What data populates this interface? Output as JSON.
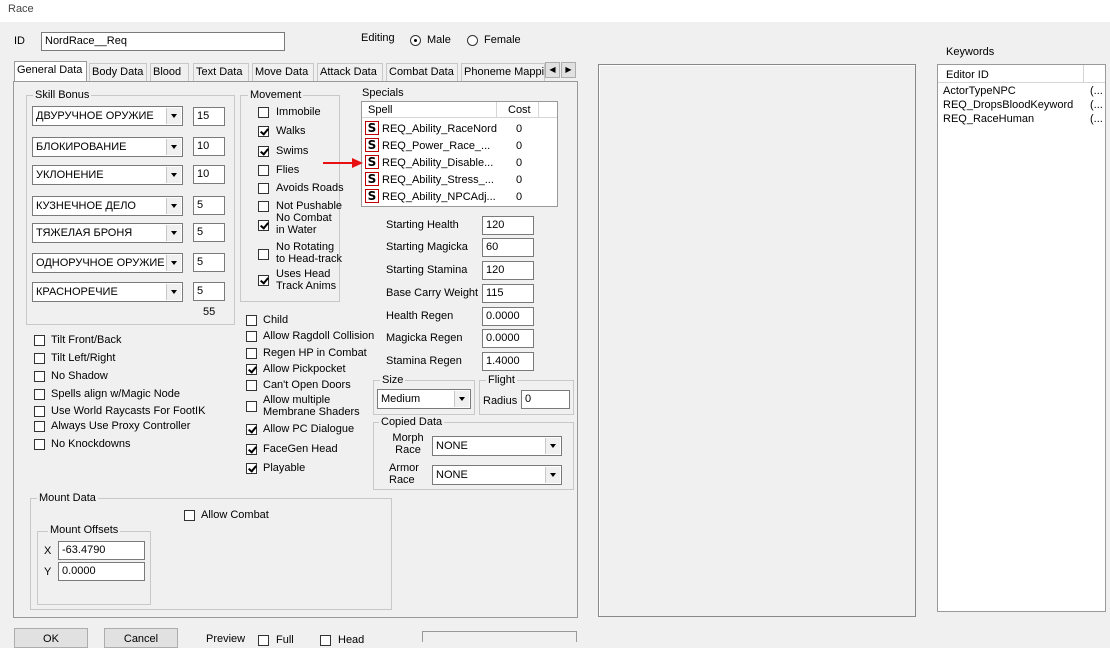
{
  "window": {
    "title": "Race"
  },
  "id_field": {
    "label": "ID",
    "value": "NordRace__Req"
  },
  "editing": {
    "label": "Editing",
    "male": "Male",
    "female": "Female",
    "selected": "male"
  },
  "tabs": [
    "General Data",
    "Body Data",
    "Blood",
    "Text Data",
    "Move Data",
    "Attack Data",
    "Combat Data",
    "Phoneme Mappi"
  ],
  "skill_bonus": {
    "label": "Skill Bonus",
    "rows": [
      {
        "skill": "ДВУРУЧНОЕ ОРУЖИЕ",
        "value": "15"
      },
      {
        "skill": "БЛОКИРОВАНИЕ",
        "value": "10"
      },
      {
        "skill": "УКЛОНЕНИЕ",
        "value": "10"
      },
      {
        "skill": "КУЗНЕЧНОЕ ДЕЛО",
        "value": "5"
      },
      {
        "skill": "ТЯЖЕЛАЯ БРОНЯ",
        "value": "5"
      },
      {
        "skill": "ОДНОРУЧНОЕ ОРУЖИЕ",
        "value": "5"
      },
      {
        "skill": "КРАСНОРЕЧИЕ",
        "value": "5"
      }
    ],
    "total": "55"
  },
  "movement": {
    "label": "Movement",
    "items": [
      {
        "label": "Immobile",
        "checked": false
      },
      {
        "label": "Walks",
        "checked": true
      },
      {
        "label": "Swims",
        "checked": true
      },
      {
        "label": "Flies",
        "checked": false
      },
      {
        "label": "Avoids Roads",
        "checked": false
      },
      {
        "label": "Not Pushable",
        "checked": false
      },
      {
        "label": "No Combat in Water",
        "checked": true
      },
      {
        "label": "No Rotating to Head-track",
        "checked": false
      },
      {
        "label": "Uses Head Track Anims",
        "checked": true
      }
    ]
  },
  "specials": {
    "label": "Specials",
    "col_spell": "Spell",
    "col_cost": "Cost",
    "icon_glyph": "S",
    "rows": [
      {
        "spell": "REQ_Ability_RaceNord",
        "cost": "0"
      },
      {
        "spell": "REQ_Power_Race_...",
        "cost": "0"
      },
      {
        "spell": "REQ_Ability_Disable...",
        "cost": "0"
      },
      {
        "spell": "REQ_Ability_Stress_...",
        "cost": "0"
      },
      {
        "spell": "REQ_Ability_NPCAdj...",
        "cost": "0"
      }
    ]
  },
  "stats": [
    {
      "label": "Starting Health",
      "value": "120"
    },
    {
      "label": "Starting Magicka",
      "value": "60"
    },
    {
      "label": "Starting Stamina",
      "value": "120"
    },
    {
      "label": "Base Carry Weight",
      "value": "115"
    },
    {
      "label": "Health Regen",
      "value": "0.0000"
    },
    {
      "label": "Magicka Regen",
      "value": "0.0000"
    },
    {
      "label": "Stamina Regen",
      "value": "1.4000"
    }
  ],
  "size": {
    "label": "Size",
    "value": "Medium"
  },
  "flight": {
    "label": "Flight",
    "radius_label": "Radius",
    "radius_value": "0"
  },
  "copied_data": {
    "label": "Copied Data",
    "morph_label": "Morph Race",
    "morph_value": "NONE",
    "armor_label": "Armor Race",
    "armor_value": "NONE"
  },
  "left_flags": [
    {
      "label": "Tilt Front/Back",
      "checked": false
    },
    {
      "label": "Tilt Left/Right",
      "checked": false
    },
    {
      "label": "No Shadow",
      "checked": false
    },
    {
      "label": "Spells align w/Magic Node",
      "checked": false
    },
    {
      "label": "Use World Raycasts For FootIK",
      "checked": false
    },
    {
      "label": "Always Use Proxy Controller",
      "checked": false
    },
    {
      "label": "No Knockdowns",
      "checked": false
    }
  ],
  "mid_flags": [
    {
      "label": "Child",
      "checked": false
    },
    {
      "label": "Allow Ragdoll Collision",
      "checked": false
    },
    {
      "label": "Regen HP in Combat",
      "checked": false
    },
    {
      "label": "Allow Pickpocket",
      "checked": true
    },
    {
      "label": "Can't Open Doors",
      "checked": false
    },
    {
      "label": "Allow multiple Membrane Shaders",
      "checked": false
    },
    {
      "label": "Allow PC Dialogue",
      "checked": true
    },
    {
      "label": "FaceGen Head",
      "checked": true
    },
    {
      "label": "Playable",
      "checked": true
    }
  ],
  "mount": {
    "label": "Mount Data",
    "allow_combat": "Allow Combat",
    "offsets_label": "Mount Offsets",
    "x_label": "X",
    "x_value": "-63.4790",
    "y_label": "Y",
    "y_value": "0.0000"
  },
  "keywords": {
    "label": "Keywords",
    "col_editor_id": "Editor ID",
    "items": [
      {
        "id": "ActorTypeNPC",
        "extra": "(..."
      },
      {
        "id": "REQ_DropsBloodKeyword",
        "extra": "(..."
      },
      {
        "id": "REQ_RaceHuman",
        "extra": "(..."
      }
    ]
  },
  "bottom": {
    "ok": "OK",
    "cancel": "Cancel",
    "preview": "Preview",
    "full": "Full",
    "head": "Head"
  },
  "colors": {
    "arrow": "#e81010",
    "spell_icon_border": "#c00000"
  }
}
